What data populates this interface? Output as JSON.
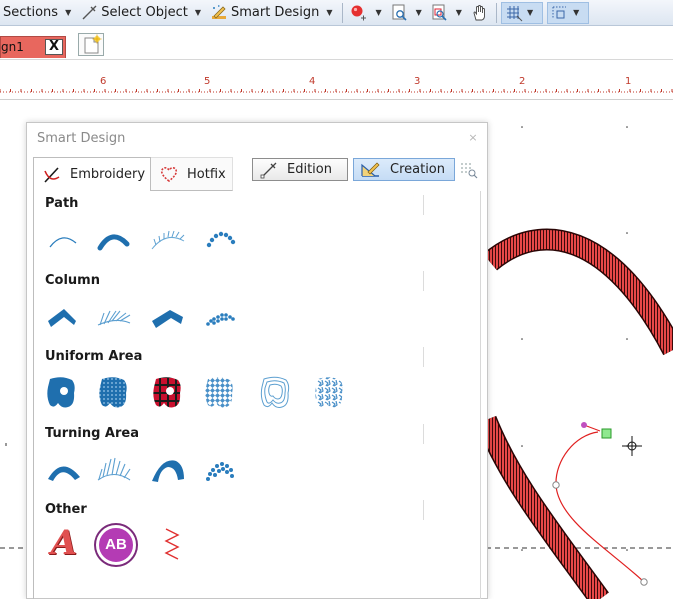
{
  "toolbar": {
    "sections_label": "Sections",
    "select_object_label": "Select Object",
    "smart_design_label": "Smart Design"
  },
  "document_tab": {
    "label": "gn1",
    "close_label": "X"
  },
  "ruler": {
    "numbers": [
      "6",
      "5",
      "4",
      "3",
      "2",
      "1"
    ]
  },
  "panel": {
    "title": "Smart Design",
    "close_label": "×",
    "tabs": [
      {
        "label": "Embroidery",
        "selected": true
      },
      {
        "label": "Hotfix",
        "selected": false
      }
    ],
    "modes": [
      {
        "label": "Edition",
        "selected": false
      },
      {
        "label": "Creation",
        "selected": true
      }
    ],
    "sections": [
      {
        "title": "Path",
        "tools": [
          "path-running-icon",
          "path-satin-icon",
          "path-motif-icon",
          "path-beads-icon"
        ]
      },
      {
        "title": "Column",
        "tools": [
          "column-satin-icon",
          "column-motif-icon",
          "column-fill-icon",
          "column-beads-icon"
        ]
      },
      {
        "title": "Uniform Area",
        "tools": [
          "uniform-fill-icon",
          "uniform-pattern-icon",
          "uniform-tartan-icon",
          "uniform-motif-icon",
          "uniform-contour-icon",
          "uniform-random-icon"
        ]
      },
      {
        "title": "Turning Area",
        "tools": [
          "turning-satin-icon",
          "turning-motif-icon",
          "turning-fill-icon",
          "turning-beads-icon"
        ]
      },
      {
        "title": "Other",
        "tools": [
          "text-icon",
          "monogram-icon",
          "zigzag-icon"
        ]
      }
    ],
    "monogram_text": "AB",
    "text_tool_letter": "A"
  },
  "colors": {
    "accent_blue": "#2a7dbd",
    "tab_red": "#e8675e",
    "stitch_red": "#e84848",
    "selection_blue": "#c5dcf5"
  }
}
